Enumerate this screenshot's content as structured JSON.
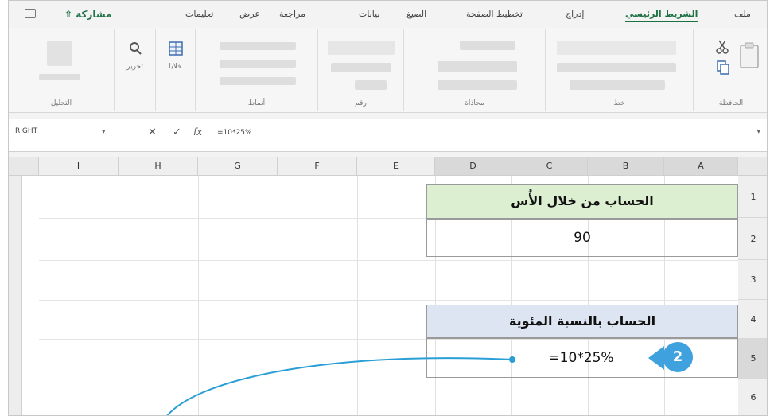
{
  "ribbon_tabs": {
    "file": "ملف",
    "home": "الشريط الرئيسي",
    "insert": "إدراج",
    "page_layout": "تخطيط الصفحة",
    "formulas": "الصيغ",
    "data": "بيانات",
    "review": "مراجعة",
    "view": "عرض",
    "help": "تعليمات",
    "share": "مشاركة"
  },
  "ribbon_groups": {
    "clipboard": "الحافظة",
    "font": "خط",
    "alignment": "محاذاة",
    "number": "رقم",
    "styles": "أنماط",
    "cells": "خلايا",
    "editing": "تحرير",
    "analysis": "التحليل"
  },
  "formula_bar": {
    "name_box": "RIGHT",
    "formula": "=10*25%"
  },
  "sheet": {
    "columns": [
      "A",
      "B",
      "C",
      "D",
      "E",
      "F",
      "G",
      "H",
      "I"
    ],
    "rows": [
      "1",
      "2",
      "3",
      "4",
      "5",
      "6"
    ],
    "cells": {
      "heading_power": "الحساب من خلال الأُس",
      "value_power": "90",
      "heading_percent": "الحساب بالنسبة المئوية",
      "editing_cell": "=10*25%"
    }
  },
  "callout": {
    "step_number": "2"
  },
  "colors": {
    "accent_green": "#1e7145",
    "header_green": "#dcefd0",
    "header_blue": "#dde4f2",
    "callout_blue": "#3fa1dd"
  }
}
